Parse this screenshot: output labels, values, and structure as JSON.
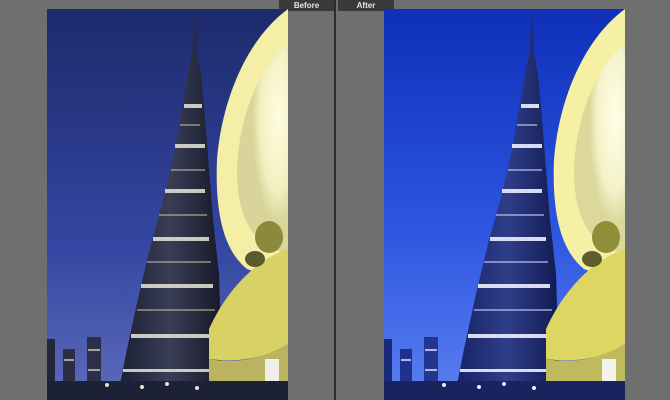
{
  "compare": {
    "before_label": "Before",
    "after_label": "After"
  },
  "colors": {
    "panel_bg": "#6f6f6f",
    "label_bg": "#3a3a3a",
    "divider": "#2c2c2c",
    "before_sky": "#2b3a8c",
    "after_sky": "#1d3fd0"
  },
  "icons": {
    "photo_before": "photo-before",
    "photo_after": "photo-after"
  }
}
